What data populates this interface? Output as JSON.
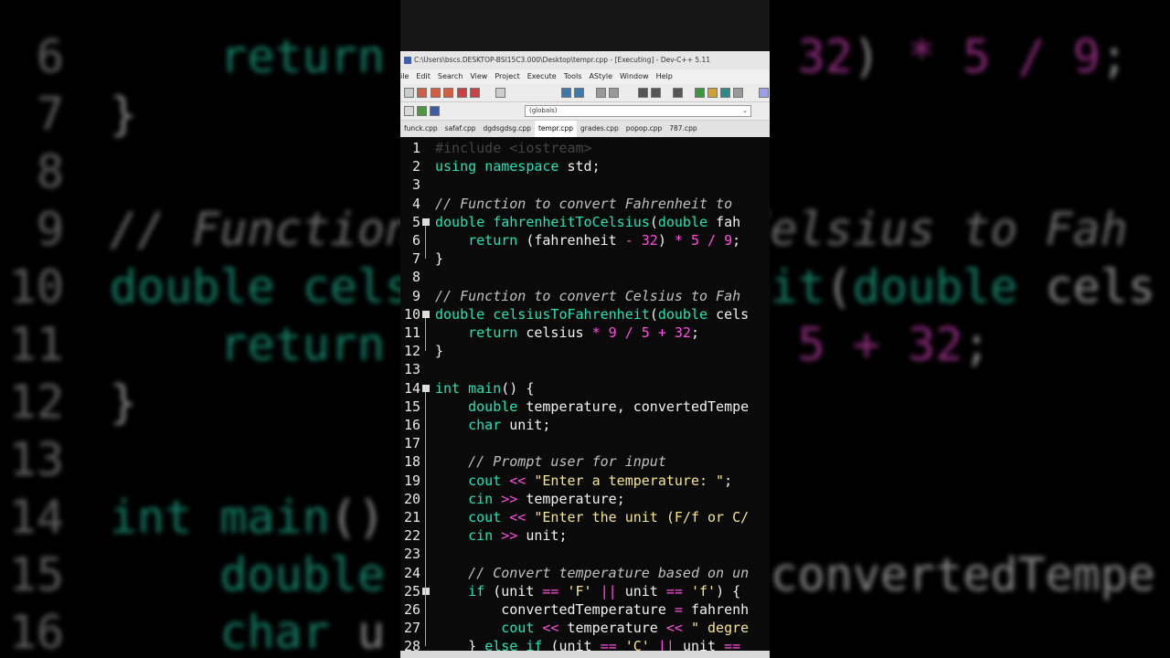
{
  "background": {
    "lines": [
      {
        "num": "6",
        "text": "    return (fahrenheit - 32) * 5 / 9;"
      },
      {
        "num": "7",
        "text": "}"
      },
      {
        "num": "8",
        "text": ""
      },
      {
        "num": "9",
        "text": "// Function to convert Celsius to Fah"
      },
      {
        "num": "10",
        "text": "double celsiusToFahrenheit(double cels"
      },
      {
        "num": "11",
        "text": "    return celsius * 9 / 5 + 32;"
      },
      {
        "num": "12",
        "text": "}"
      },
      {
        "num": "13",
        "text": ""
      },
      {
        "num": "14",
        "text": "int main() {"
      },
      {
        "num": "15",
        "text": "    double temperature, convertedTempe"
      },
      {
        "num": "16",
        "text": "    char u"
      }
    ]
  },
  "window": {
    "title": "C:\\Users\\bscs.DESKTOP-BSI15C3.000\\Desktop\\tempr.cpp - [Executing] - Dev-C++ 5.11"
  },
  "menu": [
    "ile",
    "Edit",
    "Search",
    "View",
    "Project",
    "Execute",
    "Tools",
    "AStyle",
    "Window",
    "Help"
  ],
  "scope_selector": "(globals)",
  "tabs": [
    {
      "label": "funck.cpp",
      "active": false
    },
    {
      "label": "safaf.cpp",
      "active": false
    },
    {
      "label": "dgdsgdsg.cpp",
      "active": false
    },
    {
      "label": "tempr.cpp",
      "active": true
    },
    {
      "label": "grades.cpp",
      "active": false
    },
    {
      "label": "popop.cpp",
      "active": false
    },
    {
      "label": "787.cpp",
      "active": false
    }
  ],
  "code_lines": [
    {
      "n": "1",
      "text": "#include <iostream>"
    },
    {
      "n": "2",
      "text": "using namespace std;"
    },
    {
      "n": "3",
      "text": ""
    },
    {
      "n": "4",
      "text": "// Function to convert Fahrenheit to"
    },
    {
      "n": "5",
      "text": "double fahrenheitToCelsius(double fah"
    },
    {
      "n": "6",
      "text": "    return (fahrenheit - 32) * 5 / 9;"
    },
    {
      "n": "7",
      "text": "}"
    },
    {
      "n": "8",
      "text": ""
    },
    {
      "n": "9",
      "text": "// Function to convert Celsius to Fah"
    },
    {
      "n": "10",
      "text": "double celsiusToFahrenheit(double cels"
    },
    {
      "n": "11",
      "text": "    return celsius * 9 / 5 + 32;"
    },
    {
      "n": "12",
      "text": "}"
    },
    {
      "n": "13",
      "text": ""
    },
    {
      "n": "14",
      "text": "int main() {"
    },
    {
      "n": "15",
      "text": "    double temperature, convertedTempe"
    },
    {
      "n": "16",
      "text": "    char unit;"
    },
    {
      "n": "17",
      "text": ""
    },
    {
      "n": "18",
      "text": "    // Prompt user for input"
    },
    {
      "n": "19",
      "text": "    cout << \"Enter a temperature: \";"
    },
    {
      "n": "20",
      "text": "    cin >> temperature;"
    },
    {
      "n": "21",
      "text": "    cout << \"Enter the unit (F/f or C/"
    },
    {
      "n": "22",
      "text": "    cin >> unit;"
    },
    {
      "n": "23",
      "text": ""
    },
    {
      "n": "24",
      "text": "    // Convert temperature based on un"
    },
    {
      "n": "25",
      "text": "    if (unit == 'F' || unit == 'f') {"
    },
    {
      "n": "26",
      "text": "        convertedTemperature = fahrenh"
    },
    {
      "n": "27",
      "text": "        cout << temperature << \" degre"
    },
    {
      "n": "28",
      "text": "    } else if (unit == 'C' || unit =="
    }
  ],
  "fold_lines": [
    "5",
    "10",
    "14",
    "25"
  ]
}
